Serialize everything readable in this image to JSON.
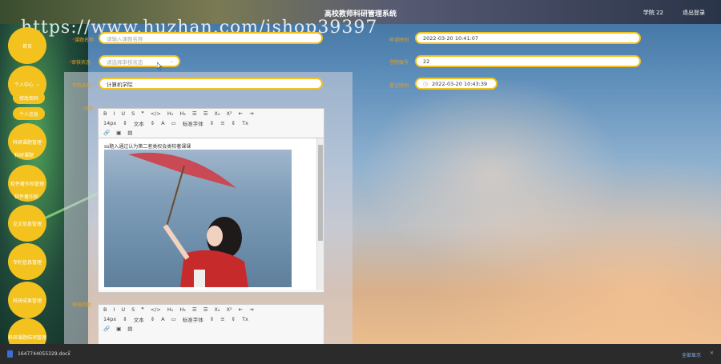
{
  "header": {
    "title": "高校教师科研管理系统",
    "user": "学院 22",
    "logout": "退出登录"
  },
  "watermark": "https://www.huzhan.com/ishop39397",
  "sidebar": {
    "items": [
      {
        "label": "首页"
      },
      {
        "label": "个人中心"
      },
      {
        "label": "科研课题管理"
      },
      {
        "label": "软件著作权管理"
      },
      {
        "label": "论文信息管理"
      },
      {
        "label": "专利信息管理"
      },
      {
        "label": "科研成果管理"
      },
      {
        "label": "科研课题结项管理"
      }
    ],
    "sub_items": {
      "change_password": "修改密码",
      "personal_info": "个人信息",
      "research_topic": "科研课题",
      "software_copyright": "软件著作权"
    }
  },
  "form": {
    "topic_name": {
      "label": "课题名称",
      "placeholder": "请输入课题名称"
    },
    "review_status": {
      "label": "审核状态",
      "placeholder": "请选择审核状态"
    },
    "college_name": {
      "label": "学院名称",
      "value": "计算机学院"
    },
    "content_label": "内容",
    "apply_time": {
      "label": "申请时间",
      "value": "2022-03-20 10:41:07"
    },
    "college_account": {
      "label": "学院账号",
      "value": "22"
    },
    "register_time": {
      "label": "登记时间",
      "value": "2022-03-20 10:43:39"
    },
    "review_reply_label": "审核回复"
  },
  "editor": {
    "toolbar_row1": [
      "B",
      "I",
      "U",
      "S",
      "❞",
      "</>",
      "H₁",
      "H₂",
      "☰",
      "☰",
      "X₂",
      "X²",
      "⇤",
      "⇥"
    ],
    "toolbar_row2": [
      "14px",
      "⇕",
      "文本",
      "⇕",
      "A",
      "▭",
      "标准字体",
      "⇕",
      "≡",
      "⇕",
      "Tx"
    ],
    "toolbar_row3": [
      "🔗",
      "▣",
      "▤"
    ],
    "content_text": "ss题入通过认为第二者类权会类较著课课"
  },
  "taskbar": {
    "file": "1647744055329.docx",
    "show_all": "全部显示"
  },
  "colors": {
    "accent": "#f3c21f",
    "label": "#e8a020"
  }
}
